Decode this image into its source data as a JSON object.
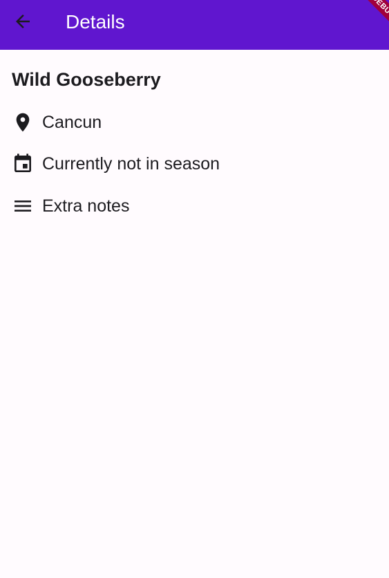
{
  "appbar": {
    "title": "Details",
    "back_icon": "arrow-back-icon",
    "background": "#6016cf"
  },
  "debug_banner": {
    "label": "DEBUG",
    "color": "#a0003c"
  },
  "plant": {
    "name": "Wild Gooseberry",
    "location": {
      "icon": "location-pin-icon",
      "text": "Cancun"
    },
    "season": {
      "icon": "calendar-icon",
      "text": "Currently not in season"
    },
    "notes": {
      "icon": "notes-icon",
      "text": "Extra notes"
    }
  }
}
